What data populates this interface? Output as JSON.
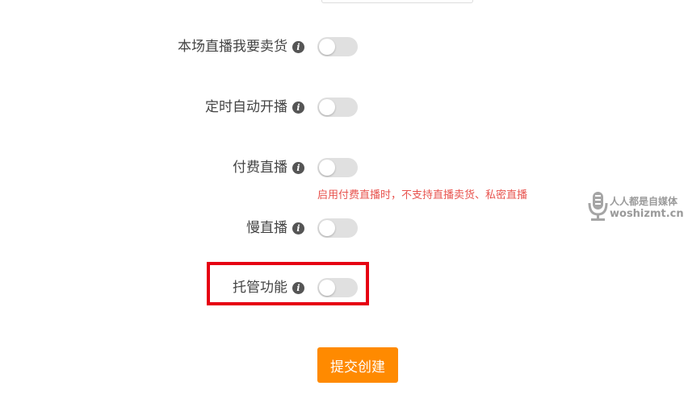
{
  "settings": [
    {
      "label": "本场直播我要卖货",
      "enabled": false
    },
    {
      "label": "定时自动开播",
      "enabled": false
    },
    {
      "label": "付费直播",
      "enabled": false
    },
    {
      "label": "慢直播",
      "enabled": false
    },
    {
      "label": "托管功能",
      "enabled": false
    }
  ],
  "paid_live_hint": "启用付费直播时，不支持直播卖货、私密直播",
  "info_icon_glyph": "i",
  "submit_label": "提交创建",
  "watermark": {
    "line1": "人人都是自媒体",
    "line2": "woshizmt.cn"
  },
  "colors": {
    "accent": "#ff8a00",
    "hint": "#e8544f",
    "highlight_border": "#e60012",
    "toggle_off": "#e0e0e0"
  }
}
